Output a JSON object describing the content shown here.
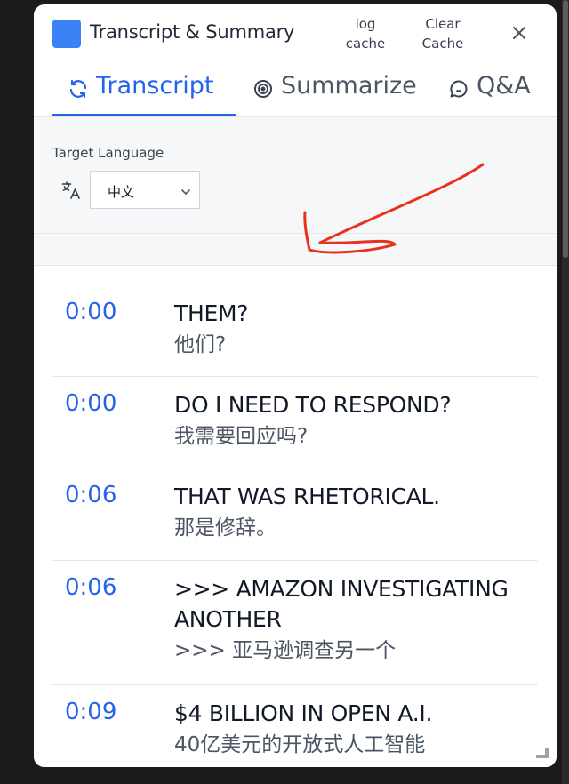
{
  "header": {
    "title": "Transcript & Summary",
    "log_cache_label": "log\ncache",
    "clear_cache_label": "Clear\nCache",
    "close_icon": "close-icon"
  },
  "tabs": [
    {
      "label": "Transcript",
      "icon": "refresh-icon",
      "active": true
    },
    {
      "label": "Summarize",
      "icon": "target-icon",
      "active": false
    },
    {
      "label": "Q&A",
      "icon": "chat-bubble-icon",
      "active": false
    }
  ],
  "settings": {
    "target_language_label": "Target Language",
    "language_value": "中文",
    "translate_icon": "translate-icon"
  },
  "annotation": {
    "color": "#e8321e"
  },
  "transcript": [
    {
      "time": "0:00",
      "en": "THEM?",
      "zh": "他们?"
    },
    {
      "time": "0:00",
      "en": "DO I NEED TO RESPOND?",
      "zh": "我需要回应吗?"
    },
    {
      "time": "0:06",
      "en": "THAT WAS RHETORICAL.",
      "zh": "那是修辞。"
    },
    {
      "time": "0:06",
      "en": ">>> AMAZON INVESTIGATING ANOTHER",
      "zh": ">>> 亚马逊调查另一个"
    },
    {
      "time": "0:09",
      "en": "$4 BILLION IN OPEN A.I.",
      "zh": "40亿美元的开放式人工智能"
    }
  ],
  "colors": {
    "accent": "#2563eb",
    "logo": "#3b82f6"
  }
}
